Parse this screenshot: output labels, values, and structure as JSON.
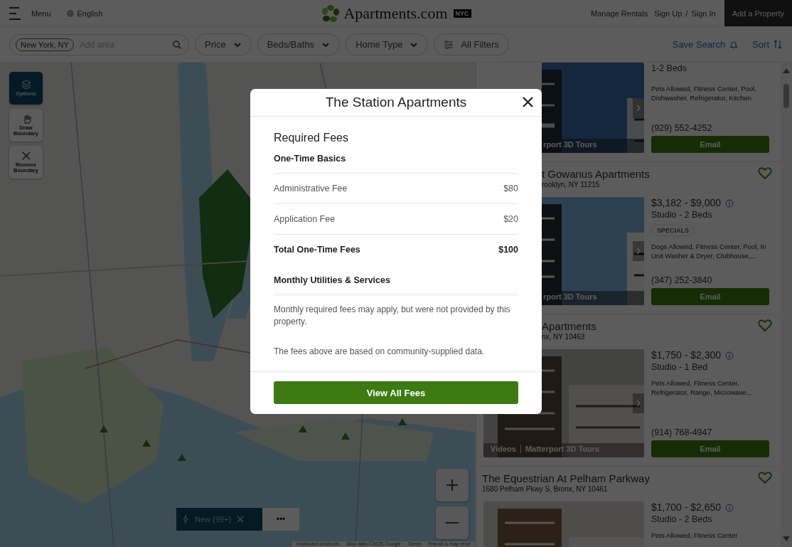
{
  "header": {
    "menu_label": "Menu",
    "language": "English",
    "logo_text": "Apartments.com",
    "logo_badge": "NYC",
    "links": [
      "Manage Rentals",
      "Sign Up",
      "Sign In"
    ],
    "separator": "/",
    "cta": "Add a Property"
  },
  "filters": {
    "location_chip": "New York, NY",
    "placeholder": "Add area",
    "buttons": [
      {
        "label": "Price",
        "kind": "dropdown"
      },
      {
        "label": "Beds/Baths",
        "kind": "dropdown"
      },
      {
        "label": "Home Type",
        "kind": "dropdown"
      },
      {
        "label": "All Filters",
        "kind": "filters"
      }
    ],
    "save_search": "Save Search",
    "sort": "Sort"
  },
  "map": {
    "tools": [
      {
        "label": "Options",
        "kind": "layers",
        "selected": true
      },
      {
        "label": "Draw Boundary",
        "kind": "draw",
        "selected": false
      },
      {
        "label": "Remove Boundary",
        "kind": "remove",
        "selected": false
      }
    ],
    "new_chip": "New (99+)",
    "more": "•••",
    "attribution": [
      "Keyboard shortcuts",
      "Map data ©2025 Google",
      "Terms",
      "Report a map error"
    ]
  },
  "listings": [
    {
      "photo_partly_hidden": true,
      "beds": "1-2 Beds",
      "amenities": "Pets Allowed, Fitness Center, Pool, Dishwasher, Refrigerator, Kitchen",
      "phone": "(929) 552-4252",
      "email": "Email",
      "media_tags": [
        "rport 3D Tours"
      ]
    },
    {
      "partly_hidden": true,
      "title": "t Gowanus Apartments",
      "address": "rooklyn, NY 11215",
      "favorite": false,
      "price": "$3,182 - $9,000",
      "beds": "Studio - 2 Beds",
      "badge": "SPECIALS",
      "amenities": "Dogs Allowed, Fitness Center, Pool, In Unit Washer & Dryer, Clubhouse,...",
      "phone": "(347) 252-3840",
      "email": "Email",
      "media_tags": [
        "rport 3D Tours"
      ],
      "photo_partly_hidden": true
    },
    {
      "partly_hidden": true,
      "title": "Apartments",
      "address": "nx, NY 10463",
      "favorite": false,
      "price": "$1,750 - $2,300",
      "beds": "Studio - 1 Bed",
      "amenities": "Pets Allowed, Fitness Center, Refrigerator, Range, Microwave...",
      "phone": "(914) 768-4947",
      "email": "Email",
      "media_tags": [
        "Videos",
        "Matterport 3D Tours"
      ]
    },
    {
      "partly_hidden": false,
      "title": "The Equestrian At Pelham Parkway",
      "address": "1680 Pelham Pkwy S, Bronx, NY 10461",
      "favorite": false,
      "price": "$1,700 - $2,650",
      "beds": "Studio - 2 Beds",
      "amenities": "Pets Allowed, Fitness Center"
    }
  ],
  "modal": {
    "title": "The Station Apartments",
    "section": "Required Fees",
    "groups": [
      {
        "heading": "One-Time Basics",
        "rows": [
          {
            "label": "Administrative Fee",
            "value": "$80",
            "kind": "fee"
          },
          {
            "label": "Application Fee",
            "value": "$20",
            "kind": "fee"
          },
          {
            "label": "Total One-Time Fees",
            "value": "$100",
            "kind": "total"
          }
        ]
      },
      {
        "heading": "Monthly Utilities & Services",
        "note": "Monthly required fees may apply, but were not provided by this property."
      }
    ],
    "footnote": "The fees above are based on community-supplied data.",
    "button": "View All Fees"
  }
}
